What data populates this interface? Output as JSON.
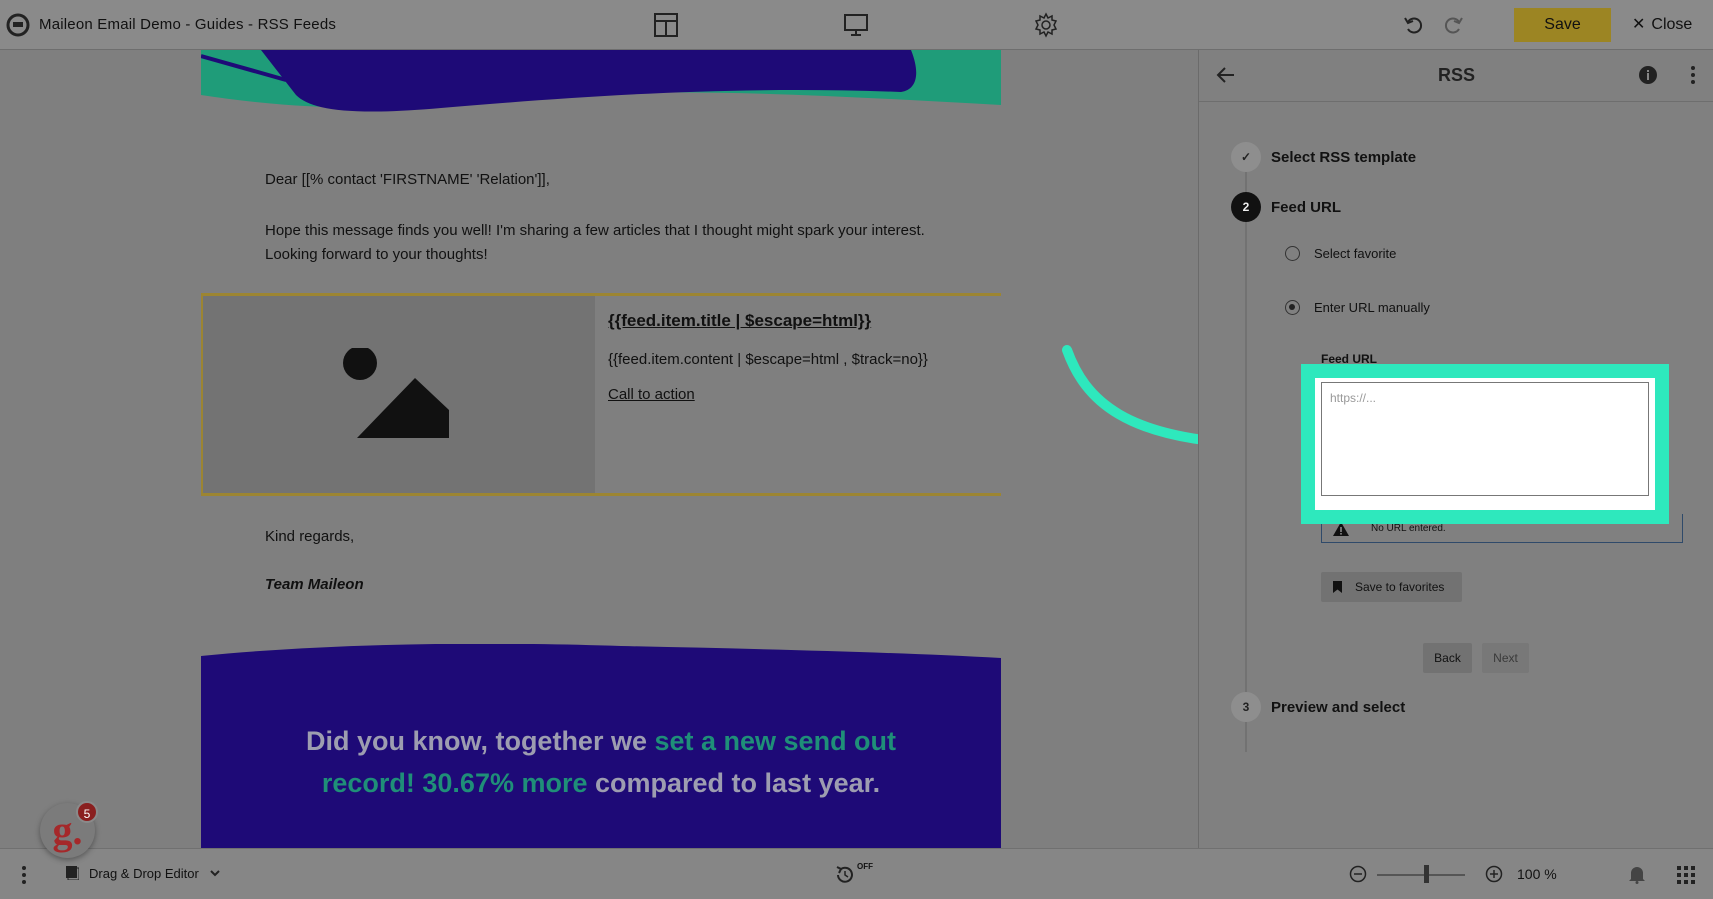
{
  "app": {
    "title": "Maileon Email Demo - Guides - RSS Feeds",
    "save_label": "Save",
    "close_label": "Close"
  },
  "email": {
    "greeting": "Dear [[% contact 'FIRSTNAME' 'Relation']],",
    "intro": "Hope this message finds you well! I'm sharing a few articles that I thought might spark your interest. Looking forward to your thoughts!",
    "feed_title": "{{feed.item.title | $escape=html}}",
    "feed_content": "{{feed.item.content | $escape=html , $track=no}}",
    "feed_cta": "Call to action",
    "regards": "Kind regards,",
    "signature": "Team Maileon",
    "footer_part1": "Did you know, together we ",
    "footer_highlight": "set a new send out record! 30.67% more",
    "footer_part2": " compared to last year."
  },
  "panel": {
    "title": "RSS",
    "steps": [
      {
        "number": "✓",
        "label": "Select RSS template",
        "state": "done"
      },
      {
        "number": "2",
        "label": "Feed URL",
        "state": "active"
      },
      {
        "number": "3",
        "label": "Preview and select",
        "state": "pending"
      }
    ],
    "option_favorite": "Select favorite",
    "option_manual": "Enter URL manually",
    "field_label": "Feed URL",
    "url_placeholder": "https://...",
    "url_value": "",
    "warning": "No URL entered.",
    "save_favorites": "Save to favorites",
    "back": "Back",
    "next": "Next"
  },
  "bottombar": {
    "editor": "Drag & Drop Editor",
    "autosave": "OFF",
    "zoom": "100 %"
  },
  "guide": {
    "letter": "g.",
    "count": "5"
  },
  "colors": {
    "save_button": "#9c8523",
    "highlight_frame": "#2ee8bd",
    "banner_purple": "#1e0a77",
    "banner_teal": "#1f9c79",
    "feed_border": "#9c8532"
  }
}
